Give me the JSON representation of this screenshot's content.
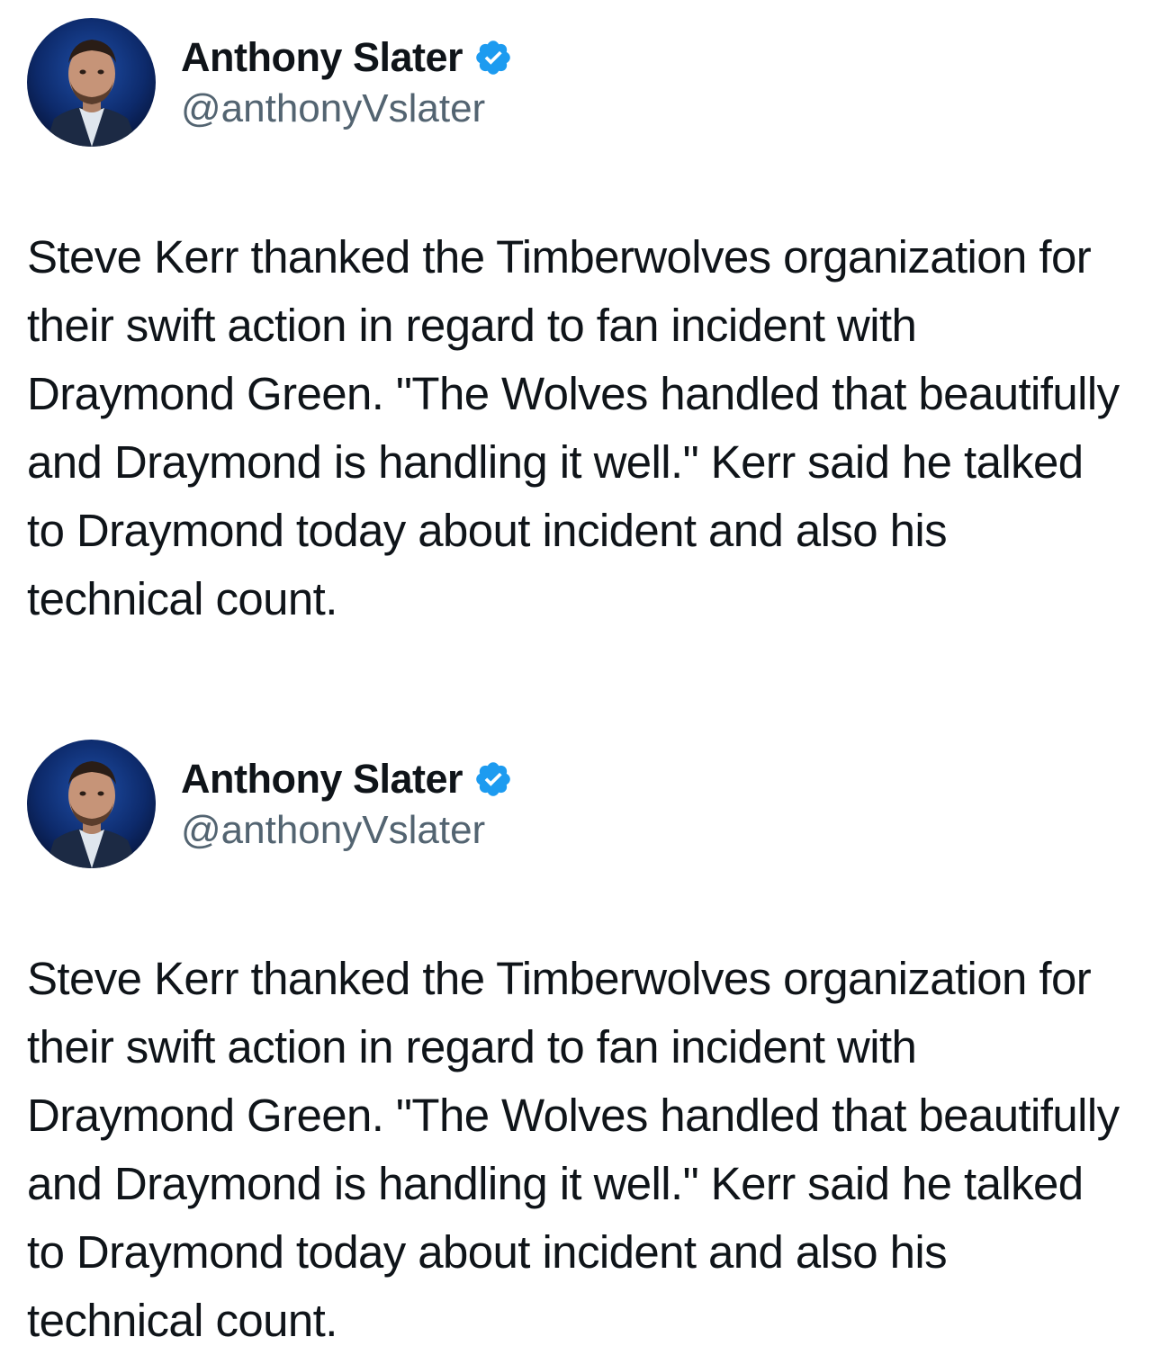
{
  "tweets": [
    {
      "author": {
        "display_name": "Anthony Slater",
        "handle": "@anthonyVslater",
        "verified": true,
        "avatar_icon": "profile-photo"
      },
      "text": "Steve Kerr thanked the Timberwolves organization for their swift action in regard to fan incident with Draymond Green. \"The Wolves handled that beautifully and Draymond is handling it well.\" Kerr said he talked to Draymond today about incident and also his technical count."
    },
    {
      "author": {
        "display_name": "Anthony Slater",
        "handle": "@anthonyVslater",
        "verified": true,
        "avatar_icon": "profile-photo"
      },
      "text": "Steve Kerr thanked the Timberwolves organization for their swift action in regard to fan incident with Draymond Green. \"The Wolves handled that beautifully and Draymond is handling it well.\" Kerr said he talked to Draymond today about incident and also his technical count."
    }
  ],
  "colors": {
    "text_primary": "#0f1419",
    "text_secondary": "#536471",
    "verified_blue": "#1d9bf0",
    "background": "#ffffff"
  }
}
